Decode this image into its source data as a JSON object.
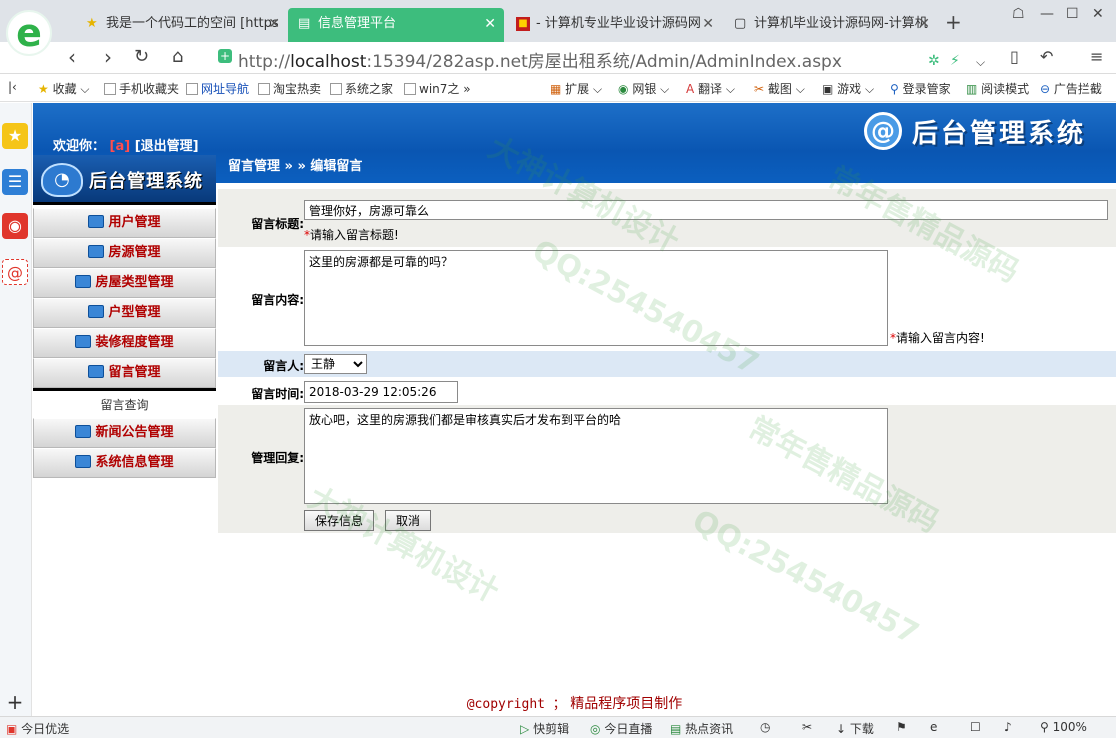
{
  "browser": {
    "logo_letter": "e",
    "tabs": [
      {
        "label": "我是一个代码工的空间 [https",
        "icon": "star-icon"
      },
      {
        "label": "信息管理平台",
        "icon": "document-icon"
      },
      {
        "label": "- 计算机专业毕业设计源码网",
        "icon": "red-site-icon"
      },
      {
        "label": "计算机毕业设计源码网-计算机",
        "icon": "document-icon"
      }
    ],
    "url_prefix": "http://",
    "url_host": "localhost",
    "url_rest": ":15394/282asp.net房屋出租系统/Admin/AdminIndex.aspx",
    "bookmarks": [
      {
        "label": "收藏"
      },
      {
        "label": "手机收藏夹"
      },
      {
        "label": "网址导航"
      },
      {
        "label": "淘宝热卖"
      },
      {
        "label": "系统之家"
      },
      {
        "label": "win7之"
      },
      {
        "label": "扩展"
      },
      {
        "label": "网银"
      },
      {
        "label": "翻译"
      },
      {
        "label": "截图"
      },
      {
        "label": "游戏"
      },
      {
        "label": "登录管家"
      },
      {
        "label": "阅读模式"
      },
      {
        "label": "广告拦截"
      }
    ]
  },
  "header": {
    "welcome": "欢迎你：",
    "user": "[a]",
    "logout": "[退出管理]",
    "brand": "后台管理系统",
    "brand_icon": "@"
  },
  "sidebar": {
    "logo_text": "后台管理系统",
    "items": [
      {
        "label": "用户管理"
      },
      {
        "label": "房源管理"
      },
      {
        "label": "房屋类型管理"
      },
      {
        "label": "户型管理"
      },
      {
        "label": "装修程度管理"
      },
      {
        "label": "留言管理"
      }
    ],
    "plain_item": "留言查询",
    "items2": [
      {
        "label": "新闻公告管理"
      },
      {
        "label": "系统信息管理"
      }
    ]
  },
  "breadcrumb": "留言管理 » » 编辑留言",
  "form": {
    "title_label": "留言标题:",
    "title_value": "管理你好，房源可靠么",
    "title_hint": "请输入留言标题!",
    "content_label": "留言内容:",
    "content_value": "这里的房源都是可靠的吗？",
    "content_hint": "请输入留言内容!",
    "person_label": "留言人:",
    "person_value": "王静",
    "time_label": "留言时间:",
    "time_value": "2018-03-29 12:05:26",
    "reply_label": "管理回复:",
    "reply_value": "放心吧，这里的房源我们都是审核真实后才发布到平台的哈",
    "save_button": "保存信息",
    "cancel_button": "取消"
  },
  "footer": {
    "copyright": "@copyright ；",
    "text": "精品程序项目制作"
  },
  "statusbar": {
    "left": "今日优选",
    "items": [
      "快剪辑",
      "今日直播",
      "热点资讯",
      "下载"
    ],
    "zoom": "100%"
  },
  "watermarks": [
    "QQ:254540457",
    "大神计算机设计",
    "常年售精品源码"
  ],
  "colors": {
    "tab_active": "#3dbd7d",
    "header_blue": "#0a56b2",
    "menu_text": "#b00000"
  }
}
